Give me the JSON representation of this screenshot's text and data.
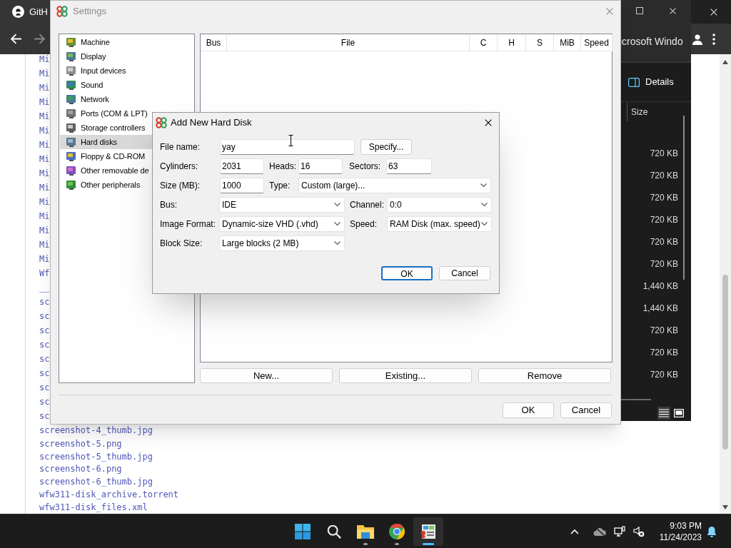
{
  "browser": {
    "tab_title": "GitH",
    "file_links": [
      "Mi",
      "Mi",
      "Mi",
      "Mi",
      "Mi",
      "Mi",
      "Mi",
      "Mi",
      "Mi",
      "Mi",
      "Mi",
      "Mi",
      "Mi",
      "Mi",
      "Mi",
      "Wf",
      "__",
      "sc",
      "sc",
      "sc",
      "sc",
      "sc",
      "sc",
      "sc",
      "sc",
      "sc",
      "screenshot-4_thumb.jpg",
      "screenshot-5.png",
      "screenshot-5_thumb.jpg",
      "screenshot-6.png",
      "screenshot-6_thumb.jpg",
      "wfw311-disk_archive.torrent",
      "wfw311-disk_files.xml"
    ]
  },
  "explorer": {
    "address": "icrosoft Windo",
    "details_label": "Details",
    "size_header": "Size",
    "sizes": [
      "720 KB",
      "720 KB",
      "720 KB",
      "720 KB",
      "720 KB",
      "720 KB",
      "1,440 KB",
      "1,440 KB",
      "720 KB",
      "720 KB",
      "720 KB"
    ],
    "views": [
      {
        "kind": "details",
        "selected": true
      },
      {
        "kind": "tiles",
        "selected": false
      }
    ]
  },
  "settings": {
    "title": "Settings",
    "categories": [
      {
        "label": "Machine",
        "selected": false
      },
      {
        "label": "Display",
        "selected": false
      },
      {
        "label": "Input devices",
        "selected": false
      },
      {
        "label": "Sound",
        "selected": false
      },
      {
        "label": "Network",
        "selected": false
      },
      {
        "label": "Ports (COM & LPT)",
        "selected": false
      },
      {
        "label": "Storage controllers",
        "selected": false
      },
      {
        "label": "Hard disks",
        "selected": true
      },
      {
        "label": "Floppy & CD-ROM",
        "selected": false
      },
      {
        "label": "Other removable de",
        "selected": false
      },
      {
        "label": "Other peripherals",
        "selected": false
      }
    ],
    "columns": [
      "Bus",
      "File",
      "C",
      "H",
      "S",
      "MiB",
      "Speed"
    ],
    "list_buttons": [
      "New...",
      "Existing...",
      "Remove"
    ],
    "buttons": [
      "OK",
      "Cancel"
    ]
  },
  "dialog": {
    "title": "Add New Hard Disk",
    "file_name": {
      "label": "File name:",
      "value": "yay"
    },
    "specify_button": "Specify...",
    "cylinders": {
      "label": "Cylinders:",
      "value": "2031"
    },
    "heads": {
      "label": "Heads:",
      "value": "16"
    },
    "sectors": {
      "label": "Sectors:",
      "value": "63"
    },
    "size": {
      "label": "Size (MB):",
      "value": "1000"
    },
    "type": {
      "label": "Type:",
      "value": "Custom (large)..."
    },
    "bus": {
      "label": "Bus:",
      "value": "IDE"
    },
    "channel": {
      "label": "Channel:",
      "value": "0:0"
    },
    "image_format": {
      "label": "Image Format:",
      "value": "Dynamic-size VHD (.vhd)"
    },
    "speed": {
      "label": "Speed:",
      "value": "RAM Disk (max. speed)"
    },
    "block_size": {
      "label": "Block Size:",
      "value": "Large blocks (2 MB)"
    },
    "buttons": [
      {
        "label": "OK",
        "default": true
      },
      {
        "label": "Cancel",
        "default": false
      }
    ]
  },
  "taskbar": {
    "apps": [
      {
        "kind": "start",
        "running": false,
        "active": false
      },
      {
        "kind": "search",
        "running": false,
        "active": false
      },
      {
        "kind": "folder",
        "running": true,
        "active": false
      },
      {
        "kind": "browser",
        "running": true,
        "active": false
      },
      {
        "kind": "emulator",
        "running": true,
        "active": true
      }
    ],
    "time": "9:03 PM",
    "date": "11/24/2023"
  }
}
